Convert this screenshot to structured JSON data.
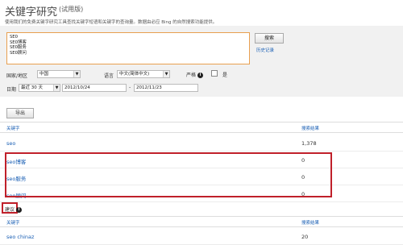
{
  "header": {
    "title": "关键字研究",
    "subtitle": "(试用版)",
    "description": "使用我们的免费关键字研究工具查找关键字短语和关键字的查询量。数据由必应 Bing 的自然搜索功能提供。"
  },
  "search": {
    "keywords": [
      "SEO",
      "SEO博客",
      "SEO服务",
      "SEO顾问"
    ],
    "search_button": "搜索",
    "history_link": "历史记录"
  },
  "filters": {
    "country_label": "国家/地区",
    "country_value": "中国",
    "language_label": "语言",
    "language_value": "中文(简体中文)",
    "strict_label": "严格",
    "strict_option": "是",
    "date_label": "日期",
    "date_range_value": "最近 30 天",
    "date_from": "2012/10/24",
    "date_sep": "-",
    "date_to": "2012/11/23"
  },
  "export_button": "导出",
  "results": {
    "col_keyword": "关键字",
    "col_count": "搜索结果",
    "rows": [
      {
        "keyword": "seo",
        "count": "1,378"
      },
      {
        "keyword": "seo博客",
        "count": "0"
      },
      {
        "keyword": "seo服务",
        "count": "0"
      },
      {
        "keyword": "seo顾问",
        "count": "0"
      }
    ]
  },
  "suggestions": {
    "label": "建议",
    "col_keyword": "关键字",
    "col_count": "搜索结果",
    "rows": [
      {
        "keyword": "seo chinaz",
        "count": "20"
      }
    ]
  },
  "colors": {
    "link": "#1a5fb4",
    "highlight": "#c0202a",
    "input_border": "#e8a050"
  }
}
